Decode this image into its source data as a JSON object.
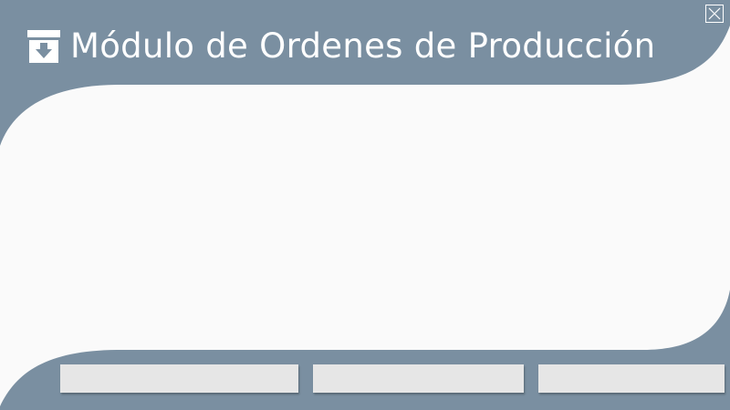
{
  "colors": {
    "frame": "#7a8fa1",
    "content_background": "#fafafa",
    "title_text": "#ffffff",
    "button_background": "#e6e6e6"
  },
  "header": {
    "title": "Módulo de Ordenes de Producción",
    "icon": "archive-download-icon"
  },
  "window_controls": {
    "close_icon": "close-icon"
  },
  "actions": {
    "button_1_label": "",
    "button_2_label": "",
    "button_3_label": ""
  }
}
